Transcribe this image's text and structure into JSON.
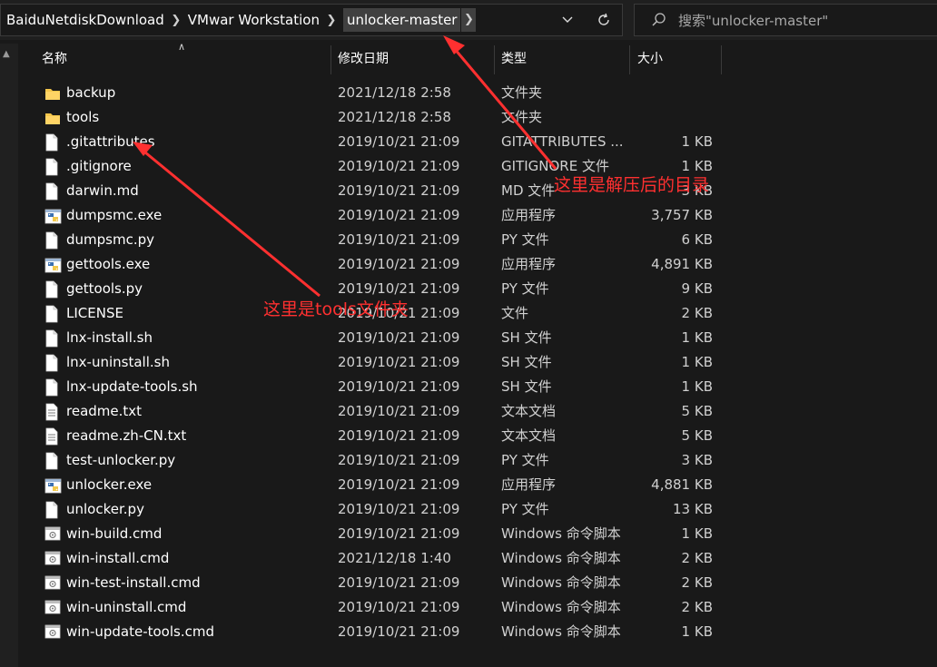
{
  "breadcrumb": {
    "items": [
      "BaiduNetdiskDownload",
      "VMwar Workstation",
      "unlocker-master"
    ]
  },
  "search": {
    "placeholder": "搜索\"unlocker-master\""
  },
  "columns": {
    "name": "名称",
    "date": "修改日期",
    "type": "类型",
    "size": "大小"
  },
  "files": [
    {
      "name": "backup",
      "date": "2021/12/18 2:58",
      "type": "文件夹",
      "size": "",
      "icon": "folder-icon"
    },
    {
      "name": "tools",
      "date": "2021/12/18 2:58",
      "type": "文件夹",
      "size": "",
      "icon": "folder-icon"
    },
    {
      "name": ".gitattributes",
      "date": "2019/10/21 21:09",
      "type": "GITATTRIBUTES ...",
      "size": "1 KB",
      "icon": "file-icon"
    },
    {
      "name": ".gitignore",
      "date": "2019/10/21 21:09",
      "type": "GITIGNORE 文件",
      "size": "1 KB",
      "icon": "file-icon"
    },
    {
      "name": "darwin.md",
      "date": "2019/10/21 21:09",
      "type": "MD 文件",
      "size": "3 KB",
      "icon": "file-icon"
    },
    {
      "name": "dumpsmc.exe",
      "date": "2019/10/21 21:09",
      "type": "应用程序",
      "size": "3,757 KB",
      "icon": "python-exe-icon"
    },
    {
      "name": "dumpsmc.py",
      "date": "2019/10/21 21:09",
      "type": "PY 文件",
      "size": "6 KB",
      "icon": "file-icon"
    },
    {
      "name": "gettools.exe",
      "date": "2019/10/21 21:09",
      "type": "应用程序",
      "size": "4,891 KB",
      "icon": "python-exe-icon"
    },
    {
      "name": "gettools.py",
      "date": "2019/10/21 21:09",
      "type": "PY 文件",
      "size": "9 KB",
      "icon": "file-icon"
    },
    {
      "name": "LICENSE",
      "date": "2019/10/21 21:09",
      "type": "文件",
      "size": "2 KB",
      "icon": "file-icon"
    },
    {
      "name": "lnx-install.sh",
      "date": "2019/10/21 21:09",
      "type": "SH 文件",
      "size": "1 KB",
      "icon": "file-icon"
    },
    {
      "name": "lnx-uninstall.sh",
      "date": "2019/10/21 21:09",
      "type": "SH 文件",
      "size": "1 KB",
      "icon": "file-icon"
    },
    {
      "name": "lnx-update-tools.sh",
      "date": "2019/10/21 21:09",
      "type": "SH 文件",
      "size": "1 KB",
      "icon": "file-icon"
    },
    {
      "name": "readme.txt",
      "date": "2019/10/21 21:09",
      "type": "文本文档",
      "size": "5 KB",
      "icon": "text-file-icon"
    },
    {
      "name": "readme.zh-CN.txt",
      "date": "2019/10/21 21:09",
      "type": "文本文档",
      "size": "5 KB",
      "icon": "text-file-icon"
    },
    {
      "name": "test-unlocker.py",
      "date": "2019/10/21 21:09",
      "type": "PY 文件",
      "size": "3 KB",
      "icon": "file-icon"
    },
    {
      "name": "unlocker.exe",
      "date": "2019/10/21 21:09",
      "type": "应用程序",
      "size": "4,881 KB",
      "icon": "python-exe-icon"
    },
    {
      "name": "unlocker.py",
      "date": "2019/10/21 21:09",
      "type": "PY 文件",
      "size": "13 KB",
      "icon": "file-icon"
    },
    {
      "name": "win-build.cmd",
      "date": "2019/10/21 21:09",
      "type": "Windows 命令脚本",
      "size": "1 KB",
      "icon": "cmd-script-icon"
    },
    {
      "name": "win-install.cmd",
      "date": "2021/12/18 1:40",
      "type": "Windows 命令脚本",
      "size": "2 KB",
      "icon": "cmd-script-icon"
    },
    {
      "name": "win-test-install.cmd",
      "date": "2019/10/21 21:09",
      "type": "Windows 命令脚本",
      "size": "2 KB",
      "icon": "cmd-script-icon"
    },
    {
      "name": "win-uninstall.cmd",
      "date": "2019/10/21 21:09",
      "type": "Windows 命令脚本",
      "size": "2 KB",
      "icon": "cmd-script-icon"
    },
    {
      "name": "win-update-tools.cmd",
      "date": "2019/10/21 21:09",
      "type": "Windows 命令脚本",
      "size": "1 KB",
      "icon": "cmd-script-icon"
    }
  ],
  "annotations": {
    "extracted_dir": "这里是解压后的目录",
    "tools_folder": "这里是tools文件夹"
  },
  "colors": {
    "background": "#191919",
    "annotation": "#ff3030",
    "folder": "#f4c64b"
  }
}
